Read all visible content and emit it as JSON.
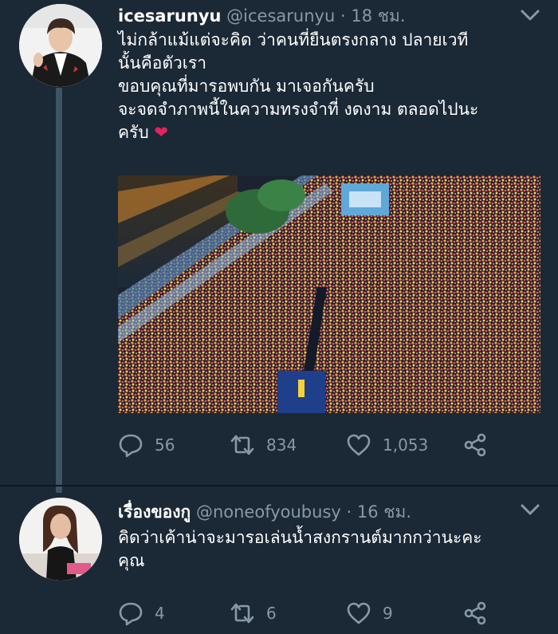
{
  "colors": {
    "background": "#1b2836",
    "secondary_text": "#8899a6",
    "thread_line": "#3d5466",
    "heart_red": "#e0245e"
  },
  "tweets": [
    {
      "display_name": "icesarunyu",
      "handle": "@icesarunyu",
      "separator": "·",
      "time": "18 ชม.",
      "text_lines": [
        "ไม่กล้าแม้แต่จะคิด ว่าคนที่ยืนตรงกลาง ปลายเวที",
        "นั้นคือตัวเรา",
        "ขอบคุณที่มารอพบกัน มาเจอกันครับ",
        "จะจดจำภาพนี้ในความทรงจำที่ งดงาม ตลอดไปนะ",
        "ครับ"
      ],
      "emoji": "❤",
      "media_icon": "concert-crowd-photo",
      "actions": {
        "reply_icon": "reply-icon",
        "reply_count": "56",
        "retweet_icon": "retweet-icon",
        "retweet_count": "834",
        "like_icon": "like-icon",
        "like_count": "1,053",
        "share_icon": "share-icon"
      }
    },
    {
      "display_name": "เรื่องของกู",
      "handle": "@noneofyoubusy",
      "separator": "·",
      "time": "16 ชม.",
      "text_lines": [
        "คิดว่าเค้าน่าจะมารอเล่นน้ำสงกรานต์มากกว่านะคะ",
        "คุณ"
      ],
      "actions": {
        "reply_icon": "reply-icon",
        "reply_count": "4",
        "retweet_icon": "retweet-icon",
        "retweet_count": "6",
        "like_icon": "like-icon",
        "like_count": "9",
        "share_icon": "share-icon"
      }
    }
  ]
}
